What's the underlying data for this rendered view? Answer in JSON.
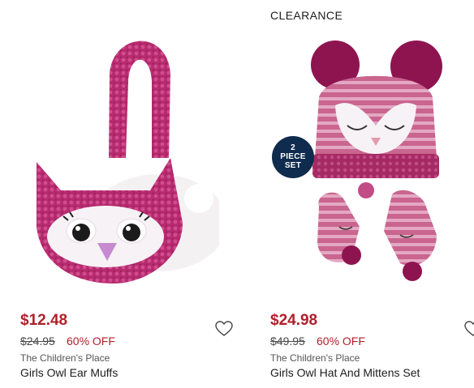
{
  "products": [
    {
      "flag": "",
      "price": "$12.48",
      "was_price": "$24.95",
      "discount": "60% OFF",
      "brand": "The Children's Place",
      "name": "Girls Owl Ear Muffs",
      "image_icon": "owl-ear-muffs-image",
      "wishlist_icon": "heart-outline-icon"
    },
    {
      "flag": "CLEARANCE",
      "price": "$24.98",
      "was_price": "$49.95",
      "discount": "60% OFF",
      "brand": "The Children's Place",
      "name": "Girls Owl Hat And Mittens Set",
      "badge_lines": [
        "2",
        "PIECE",
        "SET"
      ],
      "image_icon": "owl-hat-mittens-image",
      "wishlist_icon": "heart-outline-icon"
    }
  ],
  "colors": {
    "sale_red": "#b0202b",
    "badge_navy": "#0f2b4d",
    "product_pink": "#b8226a"
  }
}
